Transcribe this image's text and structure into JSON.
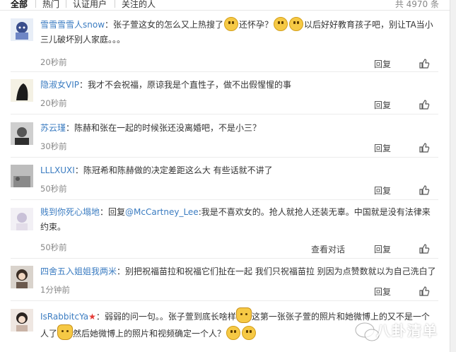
{
  "tabs": [
    {
      "label": "全部"
    },
    {
      "label": "热门"
    },
    {
      "label": "认证用户"
    },
    {
      "label": "关注的人"
    }
  ],
  "total_count": "共 4970 条",
  "reply_label": "回复",
  "view_conversation_label": "查看对话",
  "comments": [
    {
      "user": "雪雪雪雪人snow",
      "text_1": "：张子萱这女的怎么又上热搜了",
      "text_2": "还怀孕？",
      "text_3": "以后好好教育孩子吧，别让TA当小三儿破坏别人家庭。。。",
      "time": "20秒前"
    },
    {
      "user": "隐淑女VIP",
      "text": "：我才不会祝福，原谅我是个直性子，做不出假惺惺的事",
      "time": "20秒前"
    },
    {
      "user": "苏云瑾",
      "text": "：陈赫和张在一起的时候张还没离婚吧，不是小三？",
      "time": "30秒前"
    },
    {
      "user": "LLLXUXI",
      "text": "：陈冠希和陈赫做的决定差距这么大 有些话就不讲了",
      "time": "50秒前"
    },
    {
      "user": "贱到你死心塌地",
      "text_pre": "：回复",
      "mention": "@McCartney_Lee",
      "text_post": ":我是不喜欢女的。抢人就抢人还装无辜。中国就是没有法律来约束。",
      "time": "50秒前"
    },
    {
      "user": "四舍五入姐姐我两米",
      "text": "：别把祝福苗拉和祝福它们扯在一起 我们只祝福苗拉 别因为点赞数就以为自己洗白了",
      "time": "1分钟前"
    },
    {
      "user": "IsRabbitcYa",
      "text_1": "：弱弱的问一句。。张子萱到底长啥样",
      "text_2": "这第一张张子萱的照片和她微博上的又不是一个人了",
      "text_3": "然后她微博上的照片和视频确定一个人？"
    }
  ],
  "watermark_text": "八卦清单"
}
